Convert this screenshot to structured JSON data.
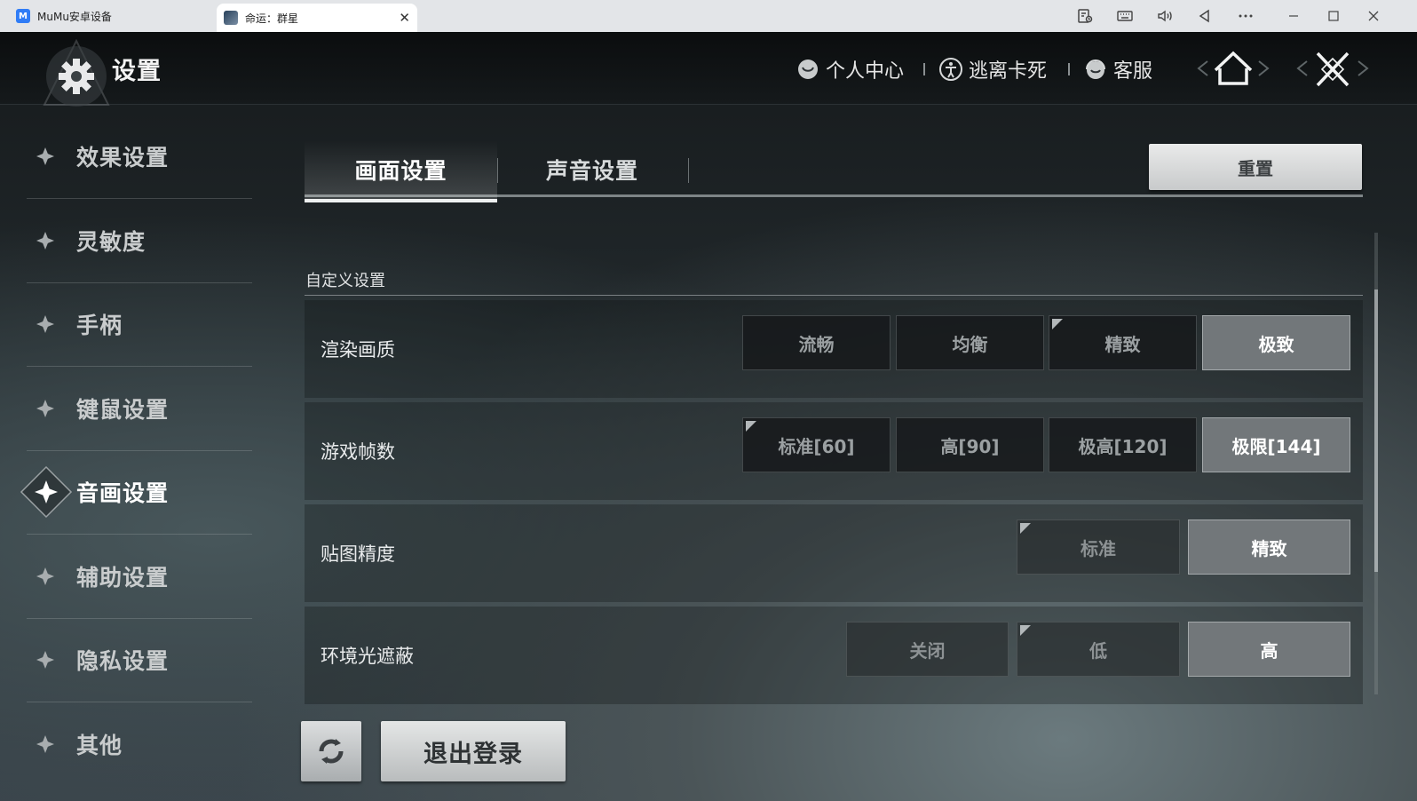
{
  "window": {
    "tabs": [
      {
        "label": "MuMu安卓设备",
        "logo": "M"
      },
      {
        "label": "命运：群星",
        "close": "✕"
      }
    ],
    "controls": [
      "bookmark-icon",
      "keyboard-icon",
      "volume-icon",
      "back-triangle-icon",
      "more-icon",
      "minimize-icon",
      "maximize-icon",
      "close-icon"
    ]
  },
  "header": {
    "title": "设置",
    "links": [
      {
        "label": "个人中心",
        "icon": "profile-icon"
      },
      {
        "label": "逃离卡死",
        "icon": "escape-icon"
      },
      {
        "label": "客服",
        "icon": "support-icon"
      }
    ],
    "home_icon": "home-icon",
    "close_icon": "close-x-icon"
  },
  "sidebar": {
    "items": [
      {
        "label": "效果设置",
        "active": false
      },
      {
        "label": "灵敏度",
        "active": false
      },
      {
        "label": "手柄",
        "active": false
      },
      {
        "label": "键鼠设置",
        "active": false
      },
      {
        "label": "音画设置",
        "active": true
      },
      {
        "label": "辅助设置",
        "active": false
      },
      {
        "label": "隐私设置",
        "active": false
      },
      {
        "label": "其他",
        "active": false
      }
    ]
  },
  "tabs": {
    "items": [
      {
        "label": "画面设置",
        "active": true
      },
      {
        "label": "声音设置",
        "active": false
      }
    ],
    "reset_label": "重置"
  },
  "content": {
    "section_label": "自定义设置",
    "rows": [
      {
        "label": "渲染画质",
        "options": [
          "流畅",
          "均衡",
          "精致",
          "极致"
        ],
        "selected": "极致",
        "marked": "精致"
      },
      {
        "label": "游戏帧数",
        "options": [
          "标准[60]",
          "高[90]",
          "极高[120]",
          "极限[144]"
        ],
        "selected": "极限[144]",
        "marked": "标准[60]"
      },
      {
        "label": "贴图精度",
        "options": [
          "标准",
          "精致"
        ],
        "selected": "精致",
        "marked": "标准"
      },
      {
        "label": "环境光遮蔽",
        "options": [
          "关闭",
          "低",
          "高"
        ],
        "selected": "高",
        "marked": "低"
      }
    ]
  },
  "footer": {
    "refresh_icon": "refresh-icon",
    "logout_label": "退出登录"
  }
}
